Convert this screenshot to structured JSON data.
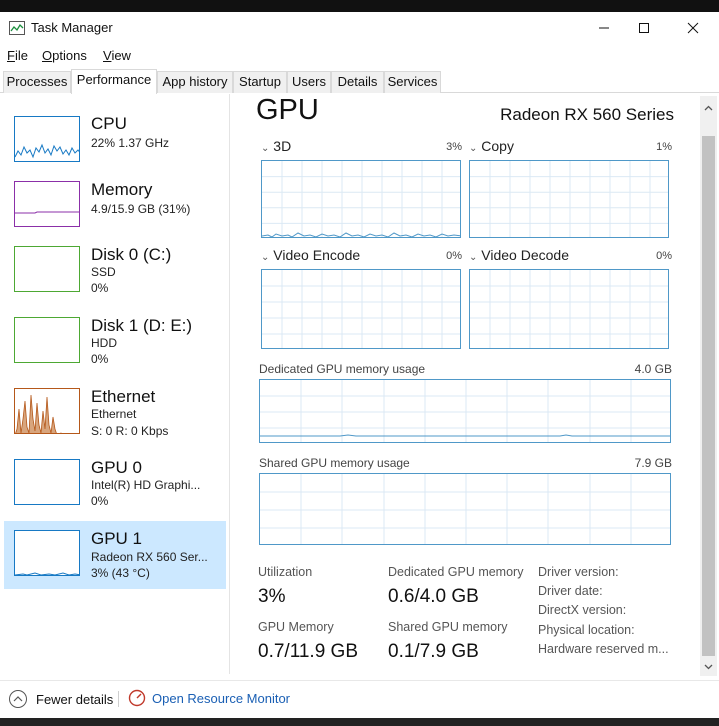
{
  "window": {
    "title": "Task Manager"
  },
  "menu": [
    {
      "label": "File",
      "u": "F",
      "rest": "ile"
    },
    {
      "label": "Options",
      "u": "O",
      "rest": "ptions"
    },
    {
      "label": "View",
      "u": "V",
      "rest": "iew"
    }
  ],
  "tabs": [
    "Processes",
    "Performance",
    "App history",
    "Startup",
    "Users",
    "Details",
    "Services"
  ],
  "active_tab": "Performance",
  "sidebar": [
    {
      "name": "CPU",
      "line1": "22%  1.37 GHz",
      "line2": "",
      "color": "#1779c4"
    },
    {
      "name": "Memory",
      "line1": "4.9/15.9 GB (31%)",
      "line2": "",
      "color": "#8b2fa8"
    },
    {
      "name": "Disk 0 (C:)",
      "line1": "SSD",
      "line2": "0%",
      "color": "#4da833"
    },
    {
      "name": "Disk 1 (D: E:)",
      "line1": "HDD",
      "line2": "0%",
      "color": "#4da833"
    },
    {
      "name": "Ethernet",
      "line1": "Ethernet",
      "line2": "S: 0  R: 0 Kbps",
      "color": "#b5581a"
    },
    {
      "name": "GPU 0",
      "line1": "Intel(R) HD Graphi...",
      "line2": "0%",
      "color": "#1779c4"
    },
    {
      "name": "GPU 1",
      "line1": "Radeon RX 560 Ser...",
      "line2": "3%  (43 °C)",
      "color": "#1779c4"
    }
  ],
  "main": {
    "title": "GPU",
    "model": "Radeon RX 560 Series",
    "engines": [
      {
        "label": "3D",
        "pct": "3%"
      },
      {
        "label": "Copy",
        "pct": "1%"
      },
      {
        "label": "Video Encode",
        "pct": "0%"
      },
      {
        "label": "Video Decode",
        "pct": "0%"
      }
    ],
    "dedicated": {
      "label": "Dedicated GPU memory usage",
      "max": "4.0 GB"
    },
    "shared": {
      "label": "Shared GPU memory usage",
      "max": "7.9 GB"
    },
    "stats": {
      "utilization_label": "Utilization",
      "utilization": "3%",
      "dedicated_label": "Dedicated GPU memory",
      "dedicated": "0.6/4.0 GB",
      "gpu_mem_label": "GPU Memory",
      "gpu_mem": "0.7/11.9 GB",
      "shared_label": "Shared GPU memory",
      "shared": "0.1/7.9 GB"
    },
    "driver": [
      "Driver version:",
      "Driver date:",
      "DirectX version:",
      "Physical location:",
      "Hardware reserved m..."
    ]
  },
  "footer": {
    "fewer": "Fewer details",
    "monitor": "Open Resource Monitor"
  }
}
